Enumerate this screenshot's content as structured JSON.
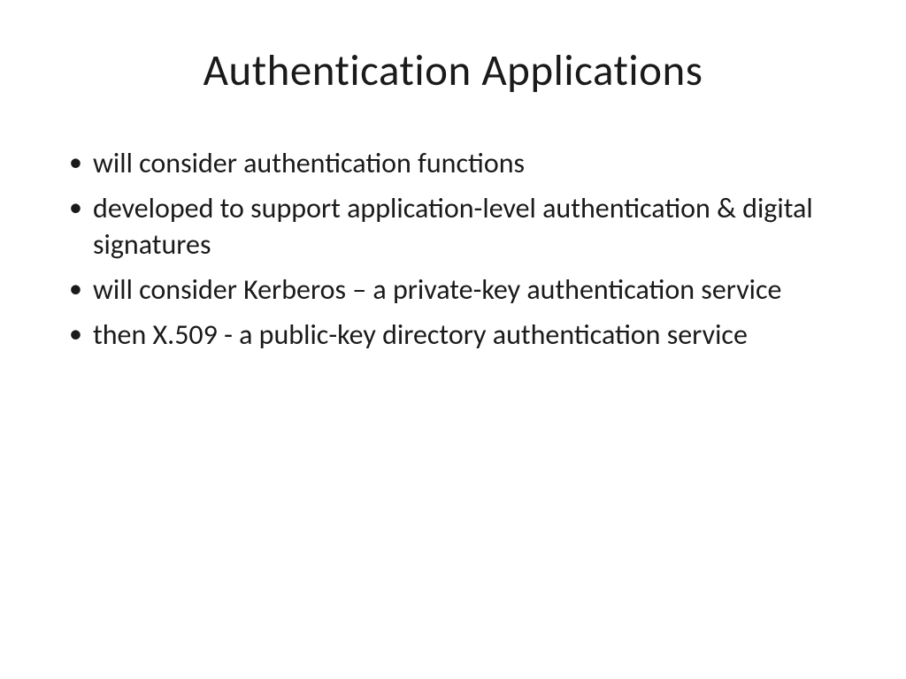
{
  "slide": {
    "title": "Authentication Applications",
    "bullets": [
      "will consider authentication functions",
      "developed to support application-level authentication & digital signatures",
      "will consider Kerberos – a private-key authentication service",
      "then X.509 - a public-key directory authentication service"
    ]
  }
}
